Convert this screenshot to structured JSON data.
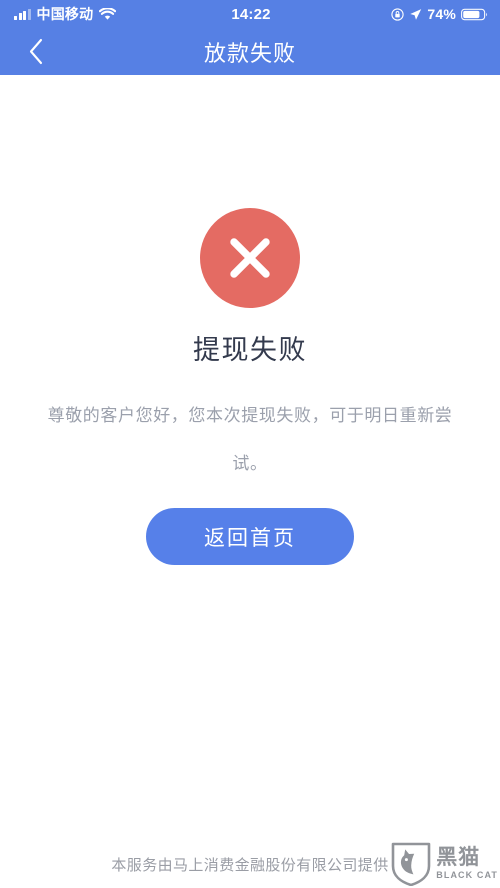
{
  "theme": {
    "header_blue": "#5680e4",
    "button_blue": "#5680e9",
    "error_red": "#e46b63",
    "title_color": "#333a4d",
    "muted_color": "#9ba0ac",
    "footer_color": "#9a9da5"
  },
  "status_bar": {
    "carrier": "中国移动",
    "signal_icon": "signal-bars-icon",
    "wifi_icon": "wifi-icon",
    "time": "14:22",
    "rotation_lock_icon": "rotation-lock-icon",
    "location_icon": "location-arrow-icon",
    "battery_percent": "74%",
    "battery_icon": "battery-icon"
  },
  "nav_bar": {
    "back_icon": "chevron-left-icon",
    "title": "放款失败"
  },
  "main": {
    "status_icon": "error-circle-x-icon",
    "title": "提现失败",
    "message": "尊敬的客户您好，您本次提现失败，可于明日重新尝试。",
    "primary_button_label": "返回首页"
  },
  "footer": {
    "text": "本服务由马上消费金融股份有限公司提供",
    "watermark": {
      "shield_icon": "black-cat-shield-icon",
      "name_cn": "黑猫",
      "name_en": "BLACK CAT"
    }
  }
}
